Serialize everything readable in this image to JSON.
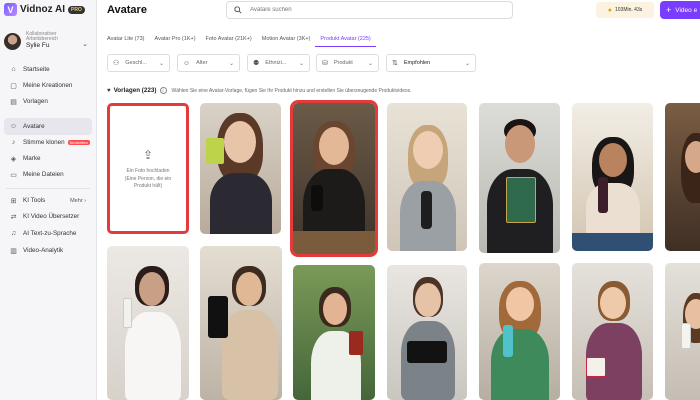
{
  "app": {
    "logo_text": "Vidnoz AI",
    "pro_badge": "PRO"
  },
  "workspace": {
    "subtitle": "Kollaborativer Arbeitsbereich",
    "name": "Sylie Fu"
  },
  "sidebar": {
    "items": [
      {
        "label": "Startseite",
        "icon": "home-icon"
      },
      {
        "label": "Meine Kreationen",
        "icon": "folder-icon"
      },
      {
        "label": "Vorlagen",
        "icon": "template-icon"
      },
      {
        "label": "Avatare",
        "icon": "avatar-icon",
        "active": true
      },
      {
        "label": "Stimme klonen",
        "icon": "voice-icon",
        "badge": "Neuheiten"
      },
      {
        "label": "Marke",
        "icon": "brand-icon"
      },
      {
        "label": "Meine Dateien",
        "icon": "files-icon"
      }
    ],
    "tools_label": "KI Tools",
    "more_label": "Mehr",
    "tools": [
      {
        "label": "KI Video Übersetzer",
        "icon": "translate-icon"
      },
      {
        "label": "AI Text-zu-Sprache",
        "icon": "tts-icon"
      },
      {
        "label": "Video-Analytik",
        "icon": "analytics-icon"
      }
    ]
  },
  "header": {
    "title": "Avatare",
    "search_placeholder": "Avatare suchen",
    "credits": "103Min. 43s",
    "video_button": "Video e"
  },
  "tabs": [
    {
      "label": "Avatar Lite (73)"
    },
    {
      "label": "Avatar Pro (1K+)"
    },
    {
      "label": "Foto Avatar (21K+)"
    },
    {
      "label": "Motion Avatar (3K+)"
    },
    {
      "label": "Produkt Avatar (225)",
      "active": true
    }
  ],
  "filters": [
    {
      "label": "Geschl...",
      "icon": "gender-icon"
    },
    {
      "label": "Alter",
      "icon": "age-icon"
    },
    {
      "label": "Ethnizi...",
      "icon": "ethnicity-icon"
    },
    {
      "label": "Produkt",
      "icon": "product-icon"
    },
    {
      "label": "Empfohlen",
      "icon": "sort-icon"
    }
  ],
  "templates": {
    "title": "Vorlagen (223)",
    "description": "Wählen Sie eine Avatar-Vorlage, fügen Sie Ihr Produkt hinzu und erstellen Sie überzeugende Produktvideos."
  },
  "upload_card": {
    "title": "Ein Foto hochladen",
    "subtitle": "(Eine Person, die ein Produkt hält)"
  },
  "colors": {
    "accent": "#7a3cff",
    "highlight": "#e33b3b"
  }
}
